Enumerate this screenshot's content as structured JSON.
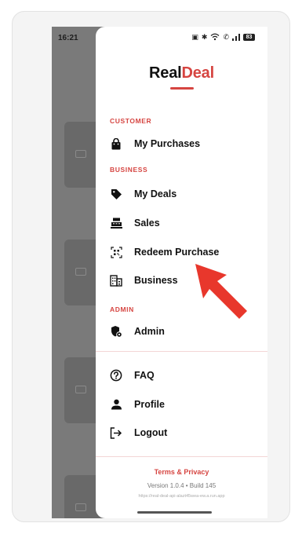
{
  "status_bar": {
    "time": "16:21",
    "battery": "83"
  },
  "brand": {
    "part1": "Real",
    "part2": "Deal",
    "accent": "#d64541"
  },
  "sections": {
    "customer": "CUSTOMER",
    "business": "BUSINESS",
    "admin": "ADMIN"
  },
  "menu": {
    "my_purchases": "My Purchases",
    "my_deals": "My Deals",
    "sales": "Sales",
    "redeem_purchase": "Redeem Purchase",
    "business": "Business",
    "admin": "Admin",
    "faq": "FAQ",
    "profile": "Profile",
    "logout": "Logout"
  },
  "footer": {
    "terms": "Terms & Privacy",
    "version": "Version 1.0.4 • Build 145",
    "url": "https://real-deal-api-alazt45wea-ew.a.run.app"
  },
  "icons": {
    "my_purchases": "shopping-bag-icon",
    "my_deals": "tag-icon",
    "sales": "cash-register-icon",
    "redeem_purchase": "qr-scan-icon",
    "business": "building-icon",
    "admin": "shield-icon",
    "faq": "help-circle-icon",
    "profile": "person-icon",
    "logout": "logout-icon"
  },
  "annotation_color": "#e8372c"
}
